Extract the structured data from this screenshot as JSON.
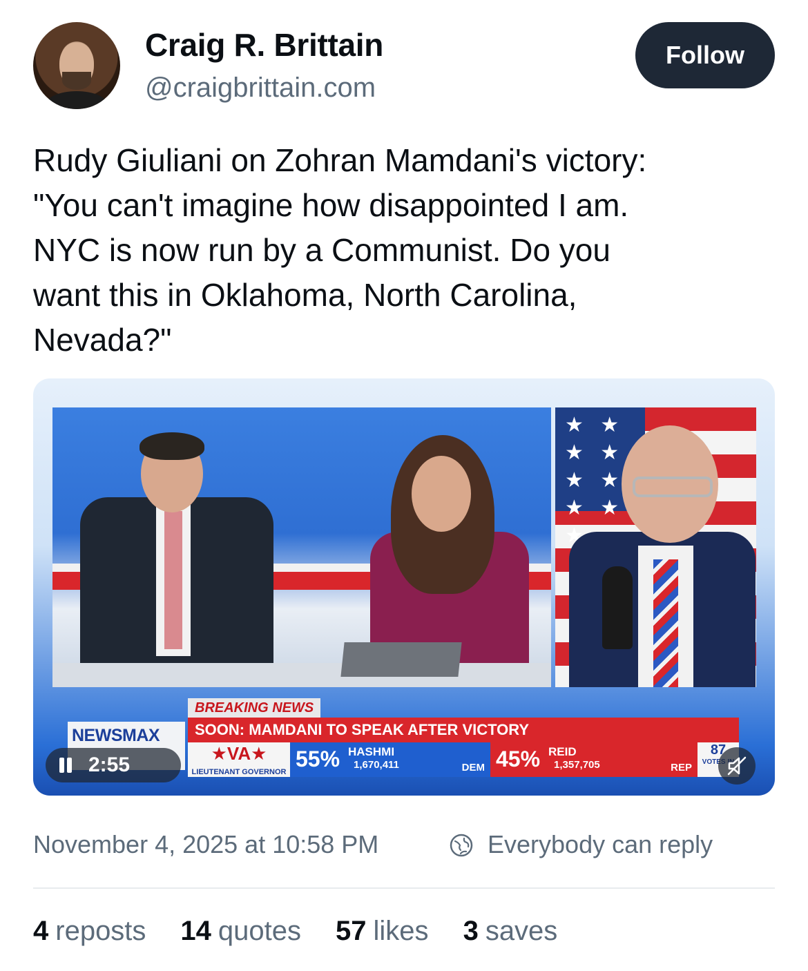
{
  "author": {
    "display_name": "Craig R. Brittain",
    "handle": "@craigbrittain.com"
  },
  "follow_label": "Follow",
  "post_text": "Rudy Giuliani on Zohran Mamdani's victory:\n\"You can't imagine how disappointed I am.\nNYC is now run by a Communist. Do you\nwant this in Oklahoma, North Carolina,\nNevada?\"",
  "video": {
    "overlay": {
      "breaking": "BREAKING NEWS",
      "headline": "SOON: MAMDANI TO SPEAK AFTER VICTORY",
      "network": "NEWSMAX",
      "state": "★VA★",
      "race": "LIEUTENANT GOVERNOR",
      "dem": {
        "pct": "55%",
        "name": "HASHMI",
        "votes": "1,670,411",
        "party": "DEM"
      },
      "rep": {
        "pct": "45%",
        "name": "REID",
        "votes": "1,357,705",
        "party": "REP"
      },
      "counted": "87",
      "counted_label": "VOTES IN"
    },
    "time_remaining": "2:55",
    "playing": true,
    "muted": true
  },
  "timestamp": "November 4, 2025 at 10:58 PM",
  "reply_setting": "Everybody can reply",
  "stats": [
    {
      "count": "4",
      "label": "reposts"
    },
    {
      "count": "14",
      "label": "quotes"
    },
    {
      "count": "57",
      "label": "likes"
    },
    {
      "count": "3",
      "label": "saves"
    }
  ],
  "colors": {
    "follow_bg": "#1e2836",
    "muted_text": "#5c6b7a",
    "headline_red": "#d9262b",
    "dem_blue": "#1f5fcf"
  }
}
